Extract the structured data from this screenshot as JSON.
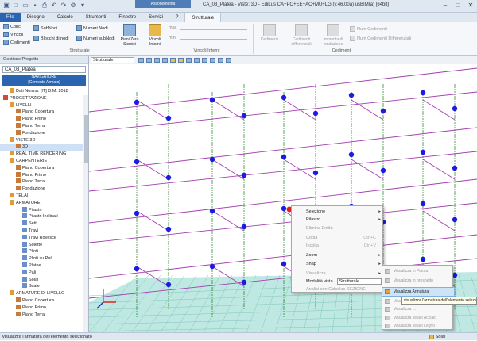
{
  "window": {
    "title": "CA_03_Platea - Viste: 3D - EdiLus CA+PO+EE+AC+MU+LG (v.46.00a) usBIM(a) [64bit]",
    "context_tab_title": "Assonometria"
  },
  "tabs": [
    "File",
    "Disegno",
    "Calcolo",
    "Strumenti",
    "Finestre",
    "Servizi",
    "?",
    "Strutturale"
  ],
  "ribbon": {
    "show_group": {
      "items": [
        "Conci",
        "Vincoli",
        "Cedimenti",
        "SubNodi",
        "Blocchi di nodi",
        "Numeri Nodi",
        "Numeri subNodi"
      ],
      "label": "Strutturale"
    },
    "vincoli": {
      "piani_zero": "Piani Zero Sismici",
      "vincoli_interni": "Vincoli Interni",
      "max": "max",
      "min": "min",
      "label": "Vincoli Interni"
    },
    "cedimenti": {
      "items": [
        "Cedimenti",
        "Cedimenti differenziali",
        "Impronta di fondazione"
      ],
      "num1": "Num Cedimenti",
      "num2": "Num Cedimenti Differenziali",
      "label": "Cedimenti"
    }
  },
  "panel": {
    "title": "Gestione Progetto",
    "project": "CA_03_Platea",
    "navigator": "NAVIGATORE",
    "navigator_sub": "[Cemento Armato]",
    "tree": [
      {
        "label": "Dati Norma: [IT] D.M. 2018",
        "indent": 1
      },
      {
        "label": "PROGETTAZIONE",
        "indent": 0
      },
      {
        "label": "LIVELLI",
        "indent": 1
      },
      {
        "label": "Piano Copertura",
        "indent": 2
      },
      {
        "label": "Piano Primo",
        "indent": 2
      },
      {
        "label": "Piano Terra",
        "indent": 2
      },
      {
        "label": "Fondazione",
        "indent": 2
      },
      {
        "label": "VISTE 3D",
        "indent": 1
      },
      {
        "label": "3D",
        "indent": 2,
        "selected": true
      },
      {
        "label": "REAL TIME RENDERING",
        "indent": 1
      },
      {
        "label": "CARPENTERIE",
        "indent": 1
      },
      {
        "label": "Piano Copertura",
        "indent": 2
      },
      {
        "label": "Piano Primo",
        "indent": 2
      },
      {
        "label": "Piano Terra",
        "indent": 2
      },
      {
        "label": "Fondazione",
        "indent": 2
      },
      {
        "label": "TELAI",
        "indent": 1
      },
      {
        "label": "ARMATURE",
        "indent": 1
      },
      {
        "label": "Pilastri",
        "indent": 3
      },
      {
        "label": "Pilastri Inclinati",
        "indent": 3
      },
      {
        "label": "Setti",
        "indent": 3
      },
      {
        "label": "Travi",
        "indent": 3
      },
      {
        "label": "Travi Rovesce",
        "indent": 3
      },
      {
        "label": "Solette",
        "indent": 3
      },
      {
        "label": "Plinti",
        "indent": 3
      },
      {
        "label": "Plinti su Pali",
        "indent": 3
      },
      {
        "label": "Platee",
        "indent": 3
      },
      {
        "label": "Pali",
        "indent": 3
      },
      {
        "label": "Solai",
        "indent": 3
      },
      {
        "label": "Scale",
        "indent": 3
      },
      {
        "label": "ARMATURE DI LIVELLO",
        "indent": 1
      },
      {
        "label": "Piano Copertura",
        "indent": 2
      },
      {
        "label": "Piano Primo",
        "indent": 2
      },
      {
        "label": "Piano Terra",
        "indent": 2
      }
    ]
  },
  "viewport": {
    "view_combo": "Strutturale"
  },
  "context_menu": {
    "items": [
      {
        "label": "Selezione",
        "submenu": true,
        "disabled": false
      },
      {
        "label": "Pilastro",
        "submenu": true,
        "disabled": false
      },
      {
        "label": "Elimina Entità",
        "disabled": true
      },
      {
        "label": "Copia",
        "shortcut": "Ctrl+C",
        "disabled": true
      },
      {
        "label": "Incolla",
        "shortcut": "Ctrl+V",
        "disabled": true
      },
      {
        "label": "Zoom",
        "submenu": true,
        "disabled": false
      },
      {
        "label": "Snap",
        "submenu": true,
        "disabled": false
      },
      {
        "label": "Visualizza",
        "submenu": true,
        "disabled": true
      },
      {
        "label": "Modalità vista",
        "value": "Strutturale",
        "disabled": false
      },
      {
        "label": "Analisi con Calcolus SEZIONE",
        "disabled": true
      }
    ]
  },
  "submenu": {
    "items": [
      {
        "label": "Visualizza in Pianta",
        "enabled": false
      },
      {
        "label": "Visualizza in prospetto",
        "enabled": false
      },
      {
        "label": "Visualizza Armatura",
        "enabled": true,
        "highlight": true
      },
      {
        "label": "Visualizza ...",
        "enabled": false
      },
      {
        "label": "Visualizza ...",
        "enabled": false
      },
      {
        "label": "Visualizza Telaio Acciaio",
        "enabled": false
      },
      {
        "label": "Visualizza Telaio Legno",
        "enabled": false
      }
    ]
  },
  "tooltip": "visualizza l'armatura dell'elemento selezionato",
  "status": {
    "text": "visualizza l'armatura dell'elemento selezionato",
    "mode": "Solai"
  }
}
